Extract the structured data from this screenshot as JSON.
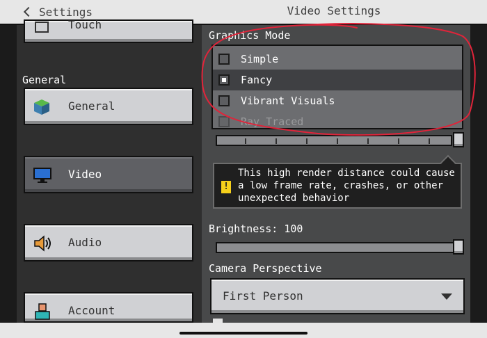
{
  "header": {
    "back_label": "Settings",
    "title": "Video Settings"
  },
  "sidebar": {
    "top_partial": "Touch",
    "section_header": "General",
    "items": [
      {
        "label": "General",
        "icon": "grass-block-icon",
        "selected": false
      },
      {
        "label": "Video",
        "icon": "monitor-icon",
        "selected": true
      },
      {
        "label": "Audio",
        "icon": "speaker-icon",
        "selected": false
      },
      {
        "label": "Account",
        "icon": "person-icon",
        "selected": false
      }
    ]
  },
  "graphics": {
    "label": "Graphics Mode",
    "options": [
      {
        "label": "Simple",
        "checked": false
      },
      {
        "label": "Fancy",
        "checked": true
      },
      {
        "label": "Vibrant Visuals",
        "checked": false
      },
      {
        "label": "Ray Traced",
        "checked": false
      }
    ]
  },
  "warning": {
    "text": "This high render distance could cause a low frame rate, crashes, or other unexpected behavior"
  },
  "brightness": {
    "label": "Brightness: 100",
    "value": 100
  },
  "camera": {
    "label": "Camera Perspective",
    "value": "First Person"
  },
  "colors": {
    "annotation": "#e0243a",
    "warning_icon": "#f5d01b"
  }
}
